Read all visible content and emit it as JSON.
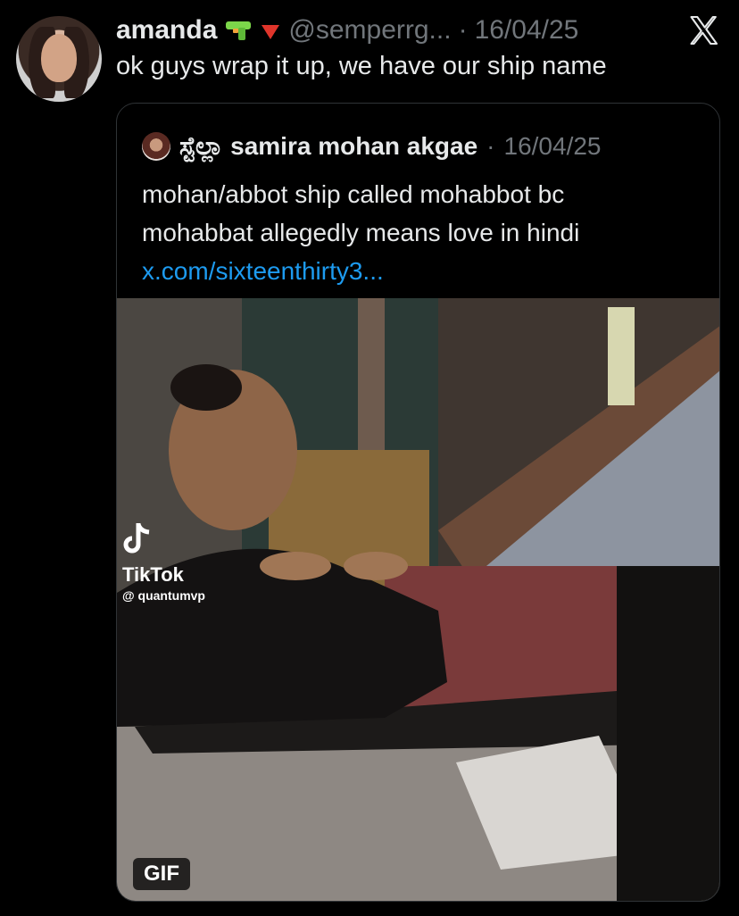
{
  "tweet": {
    "author_name": "amanda",
    "handle": "@semperrg...",
    "separator": "·",
    "date": "16/04/25",
    "text": "ok guys wrap it up, we have our ship name",
    "emojis": [
      "water-pistol-emoji",
      "red-triangle-down-emoji"
    ],
    "close_icon": "x-logo-icon"
  },
  "quote": {
    "author_name": "ಸ್ಟೆಲ್ಲಾ samira mohan akgae",
    "separator": "·",
    "date": "16/04/25",
    "text_line1": "mohan/abbot ship called mohabbot bc",
    "text_line2": "mohabbat allegedly means love in hindi",
    "link": "x.com/sixteenthirty3...",
    "media": {
      "badge": "GIF",
      "watermark": "TikTok",
      "watermark_handle": "@ quantumvp"
    }
  },
  "colors": {
    "background": "#000000",
    "text": "#e7e9ea",
    "muted": "#71767b",
    "link": "#1d9bf0",
    "border": "#2f3336"
  }
}
